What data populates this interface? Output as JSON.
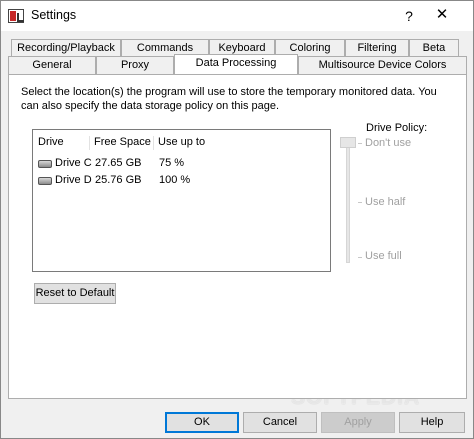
{
  "window": {
    "title": "Settings",
    "help_glyph": "?",
    "close_glyph": "✕"
  },
  "tabs_row1": [
    {
      "label": "Recording/Playback"
    },
    {
      "label": "Commands"
    },
    {
      "label": "Keyboard"
    },
    {
      "label": "Coloring"
    },
    {
      "label": "Filtering"
    },
    {
      "label": "Beta"
    }
  ],
  "tabs_row2": [
    {
      "label": "General"
    },
    {
      "label": "Proxy"
    },
    {
      "label": "Data Processing",
      "active": true
    },
    {
      "label": "Multisource Device Colors"
    }
  ],
  "panel": {
    "description": "Select the location(s) the program will use to store the temporary monitored data. You can also specify the data storage policy on this page.",
    "columns": [
      "Drive",
      "Free Space",
      "Use up to"
    ],
    "drives": [
      {
        "drive": "Drive C",
        "free": "27.65 GB",
        "use": "75 %"
      },
      {
        "drive": "Drive D",
        "free": "25.76 GB",
        "use": "100 %"
      }
    ],
    "policy_label": "Drive Policy:",
    "policy_options": [
      "Don't use",
      "Use half",
      "Use full"
    ],
    "reset_label": "Reset to Default"
  },
  "buttons": {
    "ok": "OK",
    "cancel": "Cancel",
    "apply": "Apply",
    "help": "Help"
  },
  "watermark": "SOFTPEDIA"
}
